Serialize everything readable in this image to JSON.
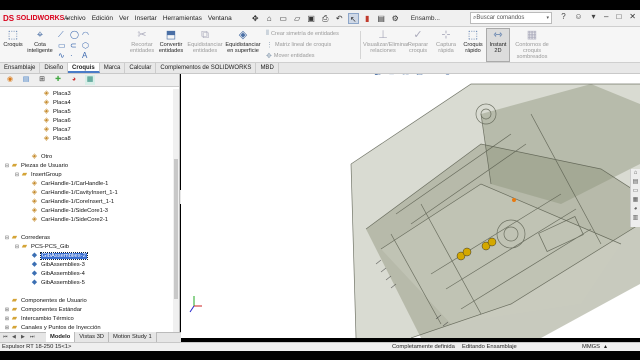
{
  "app": {
    "brand": "SOLIDWORKS",
    "brand_prefix": "DS"
  },
  "menu": [
    "Archivo",
    "Edición",
    "Ver",
    "Insertar",
    "Herramientas",
    "Ventana"
  ],
  "doc_title": "Ensamb...",
  "search": {
    "placeholder": "Buscar comandos"
  },
  "ribbon": {
    "buttons": [
      {
        "label": "Croquis",
        "icon": "sketch-icon"
      },
      {
        "label": "Cota inteligente",
        "icon": "smart-dimension-icon"
      },
      {
        "label": "Recortar entidades",
        "icon": "trim-icon"
      },
      {
        "label": "Convertir entidades",
        "icon": "convert-icon"
      },
      {
        "label": "Equidistanciar entidades",
        "icon": "offset-icon"
      },
      {
        "label": "Equidistanciar en superficie",
        "icon": "surface-offset-icon"
      },
      {
        "label": "Visualizar/Eliminar relaciones",
        "icon": "relations-icon"
      },
      {
        "label": "Reparar croquis",
        "icon": "repair-icon"
      },
      {
        "label": "Captura rápida",
        "icon": "snap-icon"
      },
      {
        "label": "Croquis rápido",
        "icon": "rapid-sketch-icon"
      },
      {
        "label": "Instant 2D",
        "icon": "instant2d-icon"
      },
      {
        "label": "Contornos de croquis sombreados",
        "icon": "shaded-sketch-icon"
      }
    ],
    "small_items": [
      "Crear simetría de entidades",
      "Matriz lineal de croquis",
      "Mover entidades"
    ]
  },
  "tabs": [
    "Ensamblaje",
    "Diseño",
    "Croquis",
    "Marca",
    "Calcular",
    "Complementos de SOLIDWORKS",
    "MBD"
  ],
  "active_tab": "Croquis",
  "tree": [
    {
      "label": "Placa3",
      "level": 3,
      "icon": "part"
    },
    {
      "label": "Placa4",
      "level": 3,
      "icon": "part"
    },
    {
      "label": "Placa5",
      "level": 3,
      "icon": "part"
    },
    {
      "label": "Placa6",
      "level": 3,
      "icon": "part"
    },
    {
      "label": "Placa7",
      "level": 3,
      "icon": "part"
    },
    {
      "label": "Placa8",
      "level": 3,
      "icon": "part"
    },
    {
      "label": "",
      "level": 3,
      "icon": "none"
    },
    {
      "label": "Otro",
      "level": 2,
      "icon": "part"
    },
    {
      "label": "Piezas de Usuario",
      "level": 0,
      "icon": "fold",
      "toggle": "−"
    },
    {
      "label": "InsertGroup",
      "level": 1,
      "icon": "fold",
      "toggle": "−"
    },
    {
      "label": "CarHandle-1/CarHandle-1",
      "level": 2,
      "icon": "part"
    },
    {
      "label": "CarHandle-1/CavityInsert_1-1",
      "level": 2,
      "icon": "part"
    },
    {
      "label": "CarHandle-1/CoreInsert_1-1",
      "level": 2,
      "icon": "part"
    },
    {
      "label": "CarHandle-1/SideCore1-3",
      "level": 2,
      "icon": "part"
    },
    {
      "label": "CarHandle-1/SideCore2-1",
      "level": 2,
      "icon": "part"
    },
    {
      "label": "",
      "level": 2,
      "icon": "none"
    },
    {
      "label": "Correderas",
      "level": 0,
      "icon": "fold",
      "toggle": "−"
    },
    {
      "label": "PCS-PCS_Gib",
      "level": 1,
      "icon": "fold",
      "toggle": "−"
    },
    {
      "label": "GibAssemblies-2",
      "level": 2,
      "icon": "asm",
      "selected": true
    },
    {
      "label": "GibAssemblies-3",
      "level": 2,
      "icon": "asm"
    },
    {
      "label": "GibAssemblies-4",
      "level": 2,
      "icon": "asm"
    },
    {
      "label": "GibAssemblies-5",
      "level": 2,
      "icon": "asm"
    },
    {
      "label": "",
      "level": 2,
      "icon": "none"
    },
    {
      "label": "Componentes de Usuario",
      "level": 0,
      "icon": "fold"
    },
    {
      "label": "Componentes Estándar",
      "level": 0,
      "icon": "fold",
      "toggle": "+"
    },
    {
      "label": "Intercambio Térmico",
      "level": 0,
      "icon": "fold",
      "toggle": "+"
    },
    {
      "label": "Canales y Puntos de Inyección",
      "level": 0,
      "icon": "fold",
      "toggle": "+"
    },
    {
      "label": "Ventilación",
      "level": 0,
      "icon": "fold"
    }
  ],
  "bottom_tabs": [
    "Modelo",
    "Vistas 3D",
    "Motion Study 1"
  ],
  "active_bottom_tab": "Modelo",
  "status": {
    "left": "Espulsor RT 18-250 15<1>",
    "definition": "Completamente definida",
    "mode": "Editando Ensamblaje",
    "units": "MMGS"
  },
  "colors": {
    "accent": "#3a6fd2",
    "brand": "#d9001b",
    "model_body": "#8a8f7a"
  }
}
